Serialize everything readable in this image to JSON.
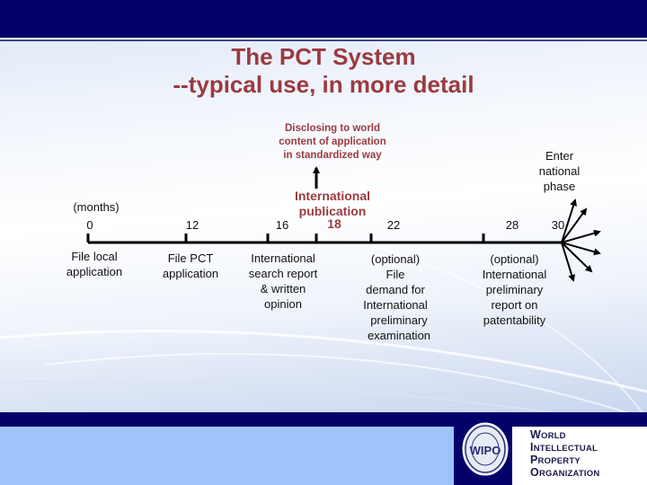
{
  "slide": {
    "title_line1": "The PCT System",
    "title_line2": "--typical use, in more detail",
    "colors": {
      "header_bar": "#04026a",
      "title_text": "#9b3a40",
      "footer_light": "#9fc3fb",
      "axis": "#000000"
    }
  },
  "timeline": {
    "unit_label": "(months)",
    "ticks": [
      {
        "month": 0,
        "label": "0",
        "highlight": false
      },
      {
        "month": 12,
        "label": "12",
        "highlight": false
      },
      {
        "month": 16,
        "label": "16",
        "highlight": false
      },
      {
        "month": 18,
        "label": "18",
        "highlight": true
      },
      {
        "month": 22,
        "label": "22",
        "highlight": false
      },
      {
        "month": 28,
        "label": "28",
        "highlight": false
      },
      {
        "month": 30,
        "label": "30",
        "highlight": false
      }
    ],
    "events": {
      "file_local": [
        "File local",
        "application"
      ],
      "file_pct": [
        "File PCT",
        "application"
      ],
      "isr": [
        "International",
        "search report",
        "& written",
        "opinion"
      ],
      "publication": [
        "International",
        "publication"
      ],
      "disclosing": [
        "Disclosing to world",
        "content of application",
        "in standardized way"
      ],
      "ipe_demand": [
        "(optional)",
        "File",
        "demand for",
        "International",
        "preliminary",
        "examination"
      ],
      "iprp": [
        "(optional)",
        "International",
        "preliminary",
        "report on",
        "patentability"
      ],
      "national_phase": [
        "Enter",
        "national",
        "phase"
      ]
    },
    "national_phase_arrow_count": 6
  },
  "footer": {
    "logo_icon": "wipo-seal-icon",
    "seal_text": "WIPO",
    "org_lines": [
      "World",
      "Intellectual",
      "Property",
      "Organization"
    ]
  }
}
